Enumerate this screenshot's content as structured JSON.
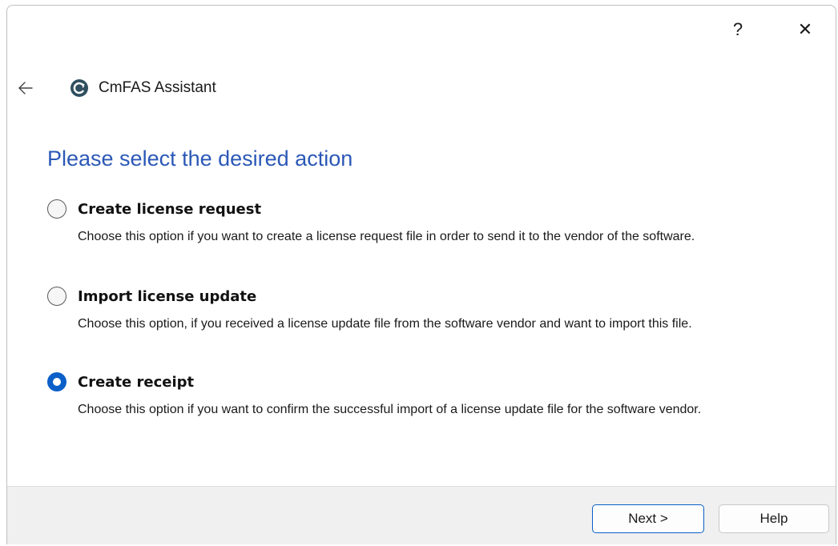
{
  "window": {
    "help_glyph": "?",
    "close_glyph": "✕"
  },
  "header": {
    "app_title": "CmFAS Assistant"
  },
  "main": {
    "heading": "Please select the desired action",
    "options": [
      {
        "label": "Create license request",
        "description": "Choose this option if you want to create a license request file in order to send it to the vendor of the software.",
        "checked": false
      },
      {
        "label": "Import license update",
        "description": "Choose this option, if you received a license update file from the software vendor and want to import this file.",
        "checked": false
      },
      {
        "label": "Create receipt",
        "description": "Choose this option if you want to confirm the successful import of a license update file for the software vendor.",
        "checked": true
      }
    ]
  },
  "footer": {
    "next_label": "Next >",
    "help_label": "Help"
  },
  "colors": {
    "accent": "#0a5fc8",
    "heading": "#2b58b7"
  },
  "icons": {
    "back": "back-arrow-icon",
    "app": "cmfas-logo-icon",
    "help": "question-mark-icon",
    "close": "close-icon"
  }
}
